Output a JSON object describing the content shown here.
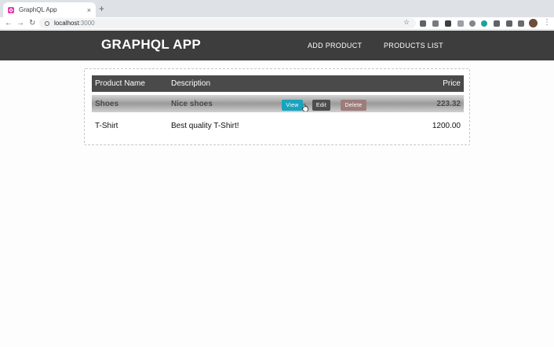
{
  "browser": {
    "tab_title": "GraphQL App",
    "tab_close": "×",
    "new_tab": "+",
    "back": "←",
    "forward": "→",
    "reload": "↻",
    "url_host": "localhost",
    "url_port": ":3000",
    "star": "☆",
    "menu": "⋮"
  },
  "app": {
    "brand": "GRAPHQL APP",
    "nav": {
      "add_product": "ADD PRODUCT",
      "products_list": "PRODUCTS LIST"
    }
  },
  "table": {
    "headers": {
      "name": "Product Name",
      "description": "Description",
      "price": "Price"
    },
    "rows": [
      {
        "name": "Shoes",
        "description": "Nice shoes",
        "price": "223.32"
      },
      {
        "name": "T-Shirt",
        "description": "Best quality T-Shirt!",
        "price": "1200.00"
      }
    ],
    "actions": {
      "view": "View",
      "edit": "Edit",
      "delete": "Delete"
    }
  },
  "colors": {
    "navbar": "#3d3d3d",
    "view_button": "#18a4be",
    "edit_button": "#4d4d4d",
    "delete_button": "#9e7c7c"
  }
}
